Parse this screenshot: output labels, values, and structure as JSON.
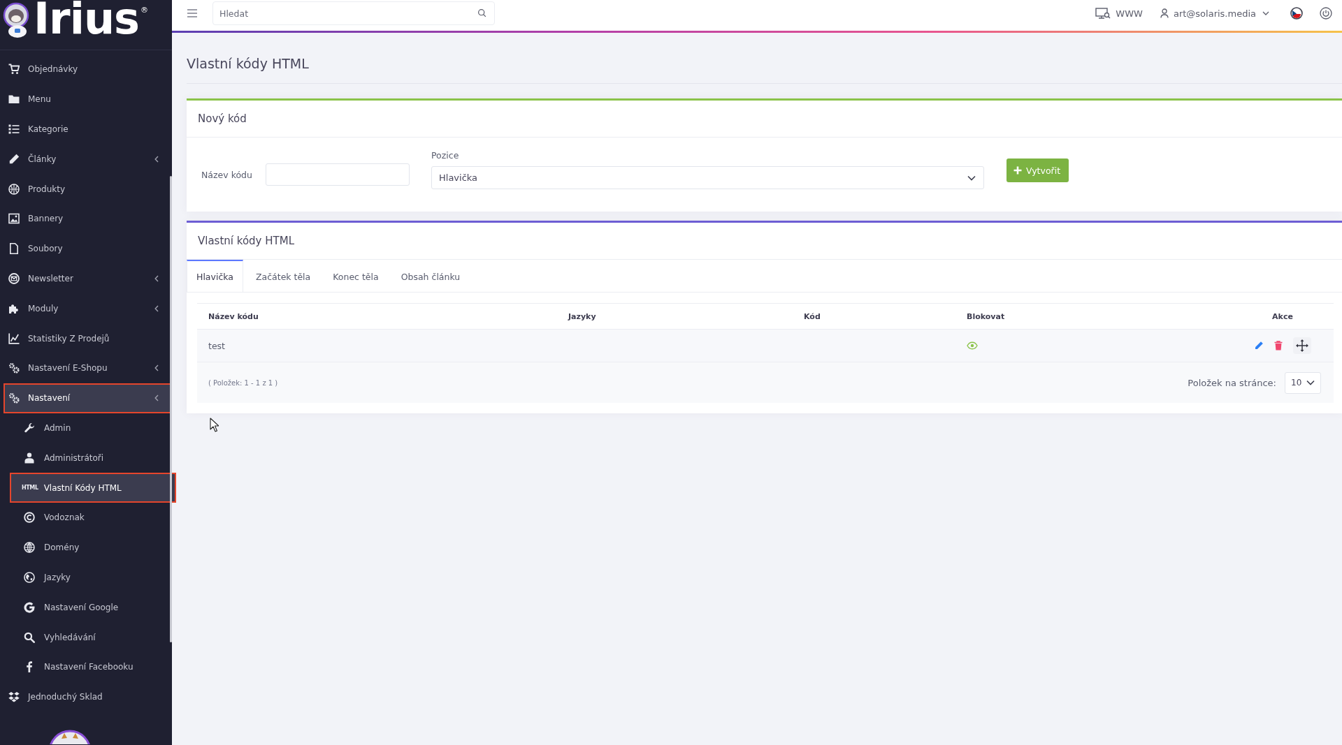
{
  "sidebar": {
    "logo": {
      "text": "Irius",
      "mark": "®"
    },
    "items": [
      {
        "label": "Objednávky",
        "submenu": false,
        "selected": false,
        "outlined": false
      },
      {
        "label": "Menu",
        "submenu": false,
        "selected": false,
        "outlined": false
      },
      {
        "label": "Kategorie",
        "submenu": false,
        "selected": false,
        "outlined": false
      },
      {
        "label": "Články",
        "submenu": true,
        "selected": false,
        "outlined": false
      },
      {
        "label": "Produkty",
        "submenu": false,
        "selected": false,
        "outlined": false
      },
      {
        "label": "Bannery",
        "submenu": false,
        "selected": false,
        "outlined": false
      },
      {
        "label": "Soubory",
        "submenu": false,
        "selected": false,
        "outlined": false
      },
      {
        "label": "Newsletter",
        "submenu": true,
        "selected": false,
        "outlined": false
      },
      {
        "label": "Moduly",
        "submenu": true,
        "selected": false,
        "outlined": false
      },
      {
        "label": "Statistiky Z Prodejů",
        "submenu": false,
        "selected": false,
        "outlined": false
      },
      {
        "label": "Nastavení E-Shopu",
        "submenu": true,
        "selected": false,
        "outlined": false
      },
      {
        "label": "Nastavení",
        "submenu": true,
        "selected": true,
        "outlined": true,
        "children": [
          {
            "label": "Admin",
            "selected": false,
            "outlined": false
          },
          {
            "label": "Administrátoři",
            "selected": false,
            "outlined": false
          },
          {
            "label": "Vlastní Kódy HTML",
            "badge": "HTML",
            "selected": true,
            "outlined": true
          },
          {
            "label": "Vodoznak",
            "selected": false,
            "outlined": false
          },
          {
            "label": "Domény",
            "selected": false,
            "outlined": false
          },
          {
            "label": "Jazyky",
            "selected": false,
            "outlined": false
          },
          {
            "label": "Nastavení Google",
            "selected": false,
            "outlined": false
          },
          {
            "label": "Vyhledávání",
            "selected": false,
            "outlined": false
          },
          {
            "label": "Nastavení Facebooku",
            "selected": false,
            "outlined": false
          }
        ]
      },
      {
        "label": "Jednoduchý Sklad",
        "submenu": false,
        "selected": false,
        "outlined": false
      }
    ]
  },
  "topbar": {
    "search": {
      "placeholder": "Hledat"
    },
    "site_link": "WWW",
    "user": "art@solaris.media"
  },
  "page": {
    "title": "Vlastní kódy HTML"
  },
  "new_code": {
    "title": "Nový kód",
    "name_field": {
      "label": "Název kódu"
    },
    "position_field": {
      "label": "Pozice",
      "value": "Hlavička"
    },
    "create_button": "Vytvořit"
  },
  "codes": {
    "title": "Vlastní kódy HTML",
    "tabs": [
      {
        "label": "Hlavička",
        "selected": true
      },
      {
        "label": "Začátek těla",
        "selected": false
      },
      {
        "label": "Konec těla",
        "selected": false
      },
      {
        "label": "Obsah článku",
        "selected": false
      }
    ],
    "table": {
      "columns": [
        "Název kódu",
        "Jazyky",
        "Kód",
        "Blokovat",
        "Akce"
      ],
      "rows": [
        {
          "name": "test",
          "blocked": false
        }
      ]
    },
    "footer": {
      "count": "( Položek: 1 - 1 z 1 )",
      "per_page_label": "Položek na stránce:",
      "per_page": "10"
    }
  }
}
